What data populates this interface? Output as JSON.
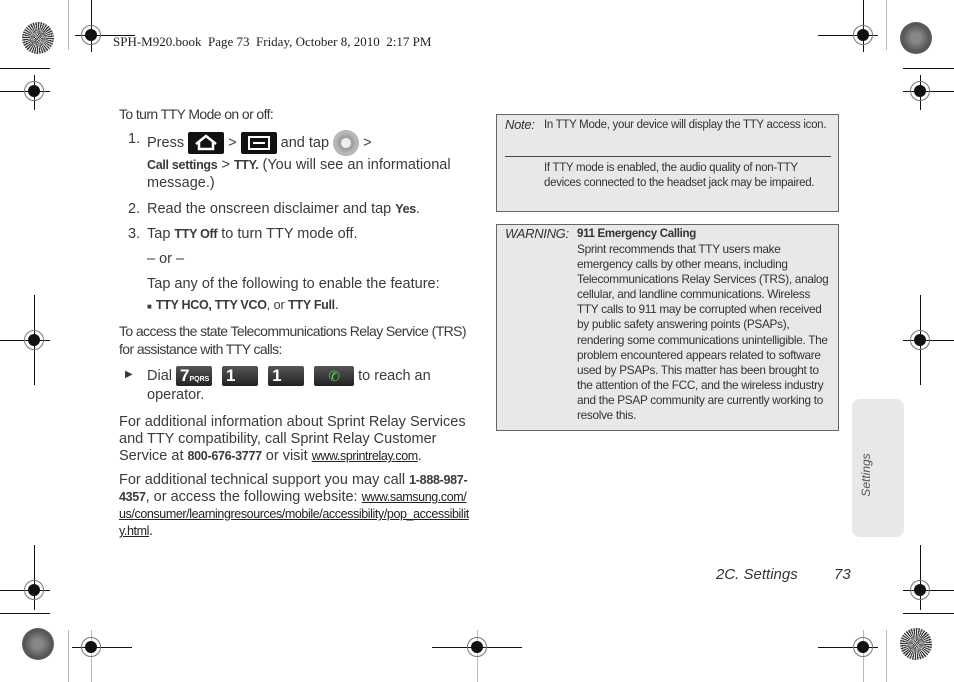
{
  "header": {
    "text": "SPH-M920.book  Page 73  Friday, October 8, 2010  2:17 PM"
  },
  "main": {
    "intro": "To turn TTY Mode on or off:",
    "steps": [
      {
        "num": "1.",
        "pre": "Press",
        "sep1": ">",
        "mid": "and tap",
        "sep2": ">",
        "bold1": "Call settings",
        "sep3": " > ",
        "bold2": "TTY.",
        "post": " (You will see an informational message.)"
      },
      {
        "num": "2.",
        "pre": "Read the onscreen disclaimer and tap ",
        "bold": "Yes",
        "post": "."
      },
      {
        "num": "3.",
        "pre": "Tap ",
        "bold": "TTY Off",
        "post": " to turn TTY mode off.",
        "or": "– or –",
        "alt": "Tap any of the following to enable the feature:",
        "bullet": {
          "b1": "TTY HCO",
          "s1": ", ",
          "b2": "TTY VCO",
          "s2": ", or ",
          "b3": "TTY Full",
          "end": "."
        }
      }
    ],
    "trs_intro": "To access the state Telecommunications Relay Service (TRS) for assistance with TTY calls:",
    "dial": {
      "pre": "Dial",
      "keys": [
        "7",
        "1",
        "1"
      ],
      "key7_sub": "PQRS",
      "post": "to reach an operator."
    },
    "relay": {
      "pre": "For additional information about Sprint Relay Services and TTY compatibility, call Sprint Relay Customer Service at ",
      "phone": "800-676-3777",
      "mid": " or visit ",
      "link": "www.sprintrelay.com",
      "end": "."
    },
    "support": {
      "pre": "For additional technical support you may call ",
      "phone": "1-888-987-4357",
      "mid": ", or access the following website: ",
      "link": "www.samsung.com/us/consumer/learningresources/mobile/accessibility/pop_accessibility.html",
      "end": "."
    }
  },
  "note": {
    "label": "Note:",
    "text1": "In TTY Mode, your device will display the TTY access icon.",
    "text2": "If TTY mode is enabled, the audio quality of non-TTY devices connected to the headset jack may be impaired."
  },
  "warning": {
    "label": "WARNING:",
    "title": "911 Emergency Calling",
    "body": "Sprint recommends that TTY users make emergency calls by other means, including Telecommunications Relay Services (TRS), analog cellular, and landline communications. Wireless TTY calls to 911 may be corrupted when received by public safety answering points (PSAPs), rendering some communications unintelligible. The problem encountered appears related to software used by PSAPs. This matter has been brought to the attention of the FCC, and the wireless industry and the PSAP community are currently working to resolve this."
  },
  "side_tab": {
    "label": "Settings"
  },
  "footer": {
    "section": "2C. Settings",
    "page": "73"
  },
  "icons": {
    "home": "home-key-icon",
    "menu": "menu-key-icon",
    "settings": "settings-icon",
    "call": "call-key-icon"
  }
}
